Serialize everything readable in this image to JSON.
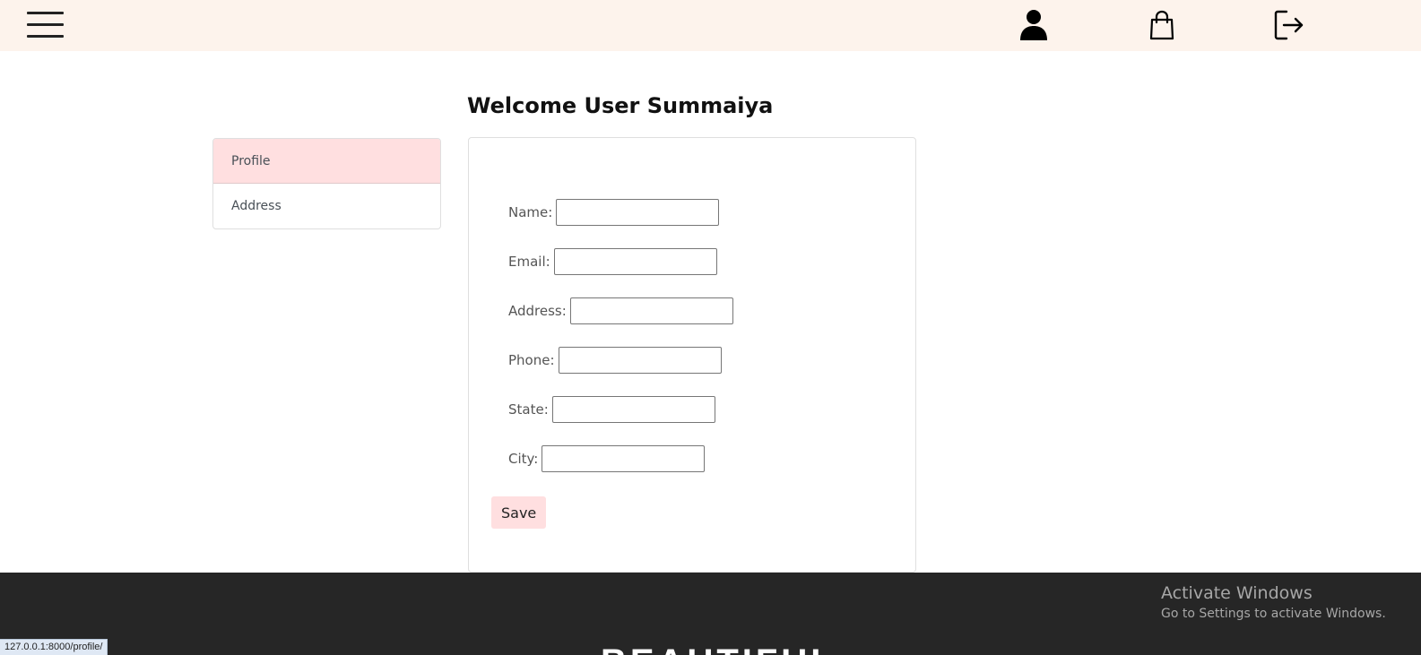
{
  "header": {
    "menu_icon": "hamburger-menu-icon",
    "icons": [
      "user-icon",
      "shopping-bag-icon",
      "logout-icon"
    ]
  },
  "main": {
    "title": "Welcome User Summaiya",
    "sidebar": {
      "items": [
        {
          "label": "Profile",
          "active": true
        },
        {
          "label": "Address",
          "active": false
        }
      ]
    },
    "form": {
      "fields": [
        {
          "label": "Name:",
          "value": ""
        },
        {
          "label": "Email:",
          "value": ""
        },
        {
          "label": "Address:",
          "value": ""
        },
        {
          "label": "Phone:",
          "value": ""
        },
        {
          "label": "State:",
          "value": ""
        },
        {
          "label": "City:",
          "value": ""
        }
      ],
      "save_label": "Save"
    }
  },
  "footer": {
    "brand": "BEAUTIFUL"
  },
  "watermark": {
    "title": "Activate Windows",
    "subtitle": "Go to Settings to activate Windows."
  },
  "status_bar": {
    "url": "127.0.0.1:8000/profile/"
  },
  "colors": {
    "header_bg": "#fdf3ec",
    "accent_pink": "#ffdfe0",
    "footer_bg": "#262626"
  }
}
